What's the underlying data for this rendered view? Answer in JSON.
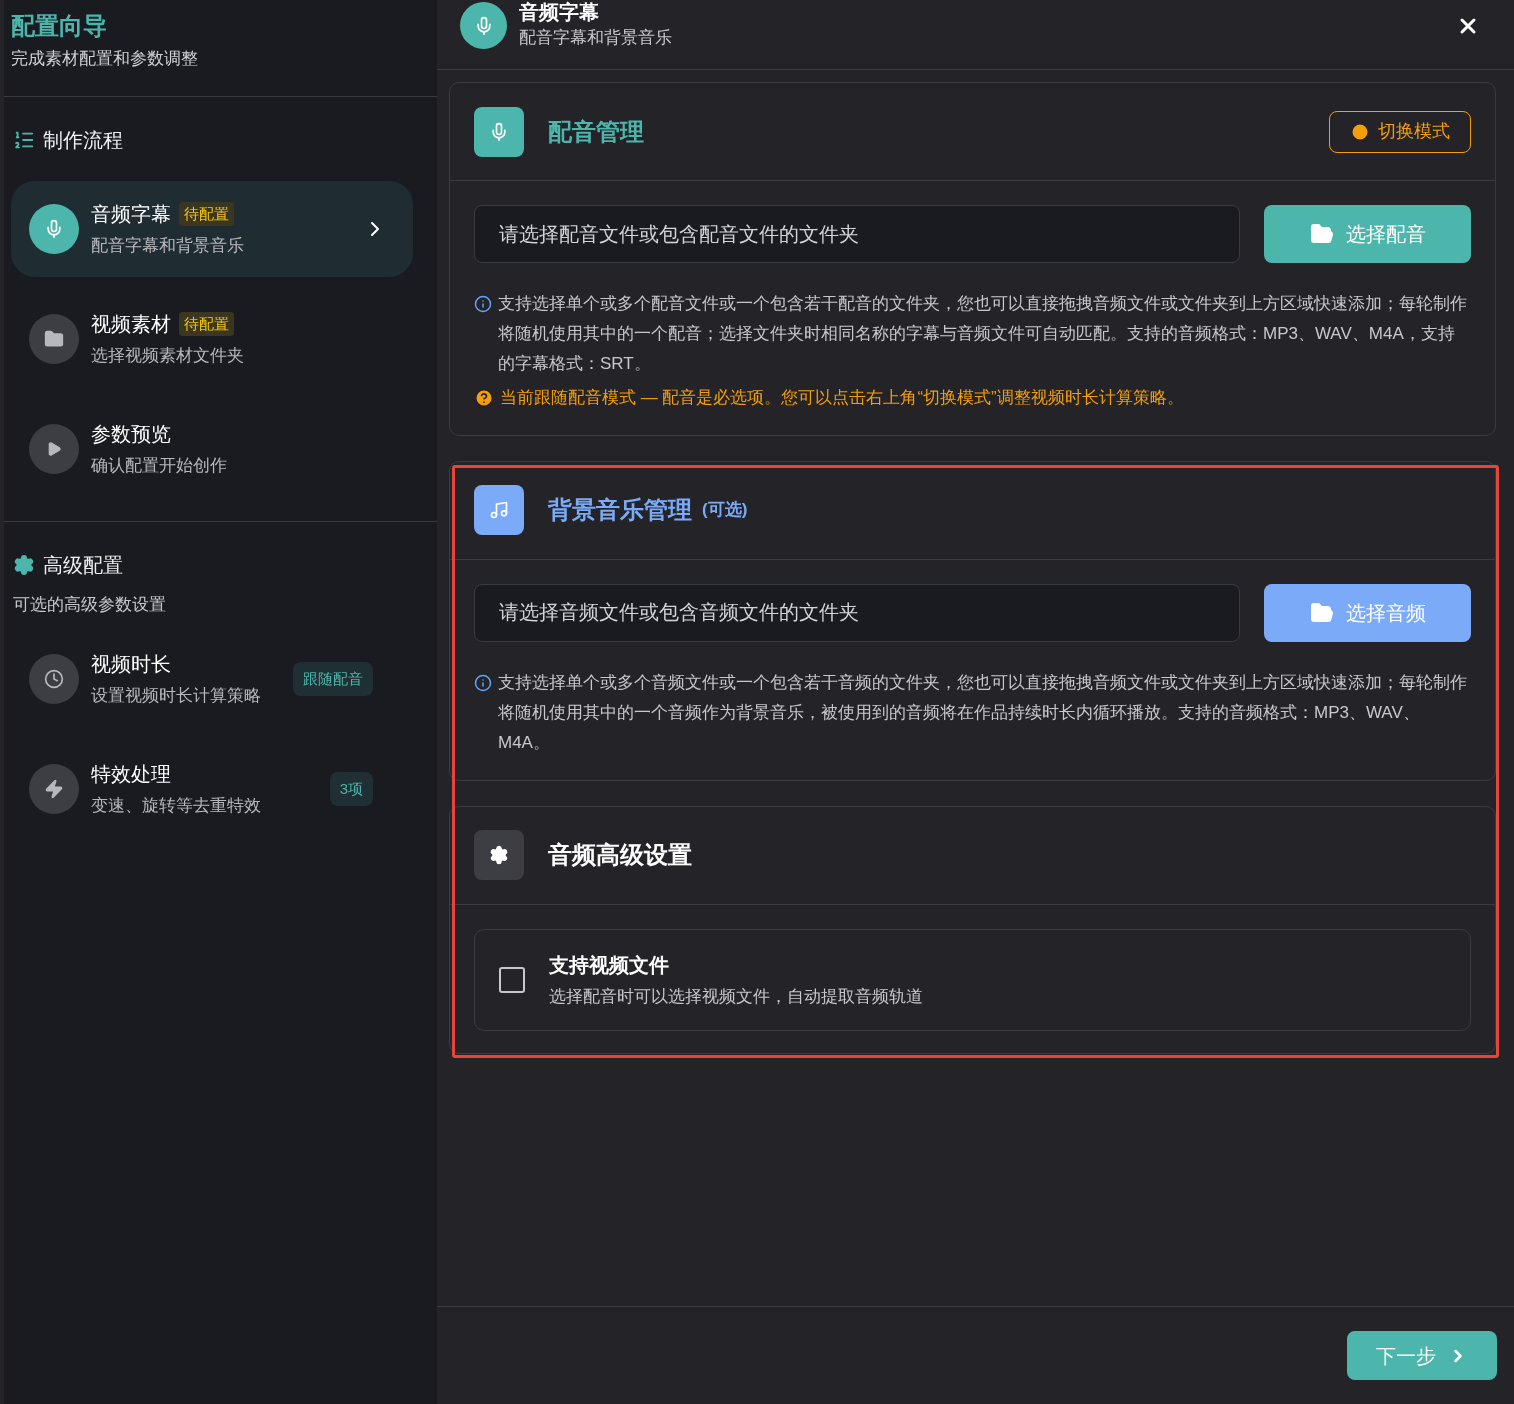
{
  "sidebar": {
    "title": "配置向导",
    "subtitle": "完成素材配置和参数调整",
    "flow_heading": "制作流程",
    "steps": [
      {
        "title": "音频字幕",
        "badge": "待配置",
        "subtitle": "配音字幕和背景音乐",
        "selected": true
      },
      {
        "title": "视频素材",
        "badge": "待配置",
        "subtitle": "选择视频素材文件夹",
        "selected": false
      },
      {
        "title": "参数预览",
        "subtitle": "确认配置开始创作",
        "selected": false
      }
    ],
    "advanced": {
      "heading": "高级配置",
      "subtitle": "可选的高级参数设置",
      "items": [
        {
          "title": "视频时长",
          "subtitle": "设置视频时长计算策略",
          "badge": "跟随配音"
        },
        {
          "title": "特效处理",
          "subtitle": "变速、旋转等去重特效",
          "badge": "3项"
        }
      ]
    }
  },
  "header": {
    "title": "音频字幕",
    "subtitle": "配音字幕和背景音乐"
  },
  "voice": {
    "title": "配音管理",
    "mode_button": "切换模式",
    "placeholder": "请选择配音文件或包含配音文件的文件夹",
    "button": "选择配音",
    "info": "支持选择单个或多个配音文件或一个包含若干配音的文件夹，您也可以直接拖拽音频文件或文件夹到上方区域快速添加；每轮制作将随机使用其中的一个配音；选择文件夹时相同名称的字幕与音频文件可自动匹配。支持的音频格式：MP3、WAV、M4A，支持的字幕格式：SRT。",
    "warning": "当前跟随配音模式 — 配音是必选项。您可以点击右上角“切换模式”调整视频时长计算策略。"
  },
  "bgm": {
    "title": "背景音乐管理",
    "optional": "(可选)",
    "placeholder": "请选择音频文件或包含音频文件的文件夹",
    "button": "选择音频",
    "info": "支持选择单个或多个音频文件或一个包含若干音频的文件夹，您也可以直接拖拽音频文件或文件夹到上方区域快速添加；每轮制作将随机使用其中的一个音频作为背景音乐，被使用到的音频将在作品持续时长内循环播放。支持的音频格式：MP3、WAV、M4A。"
  },
  "audio_settings": {
    "title": "音频高级设置",
    "options": [
      {
        "title": "支持视频文件",
        "description": "选择配音时可以选择视频文件，自动提取音频轨道",
        "checked": false
      }
    ]
  },
  "footer": {
    "next_button": "下一步"
  }
}
